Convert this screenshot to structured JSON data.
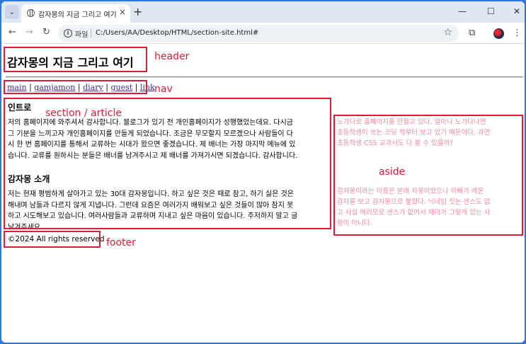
{
  "browser": {
    "tab_title": "감자몽의 지금 그리고 여기",
    "file_chip": "파일",
    "url": "C:/Users/AA/Desktop/HTML/section-site.html#",
    "new_tab_symbol": "+",
    "close_symbol": "×"
  },
  "page": {
    "header_title": "감자몽의 지금 그리고 여기",
    "nav": {
      "links": [
        "main",
        "gamjamon",
        "diary",
        "guest",
        "link"
      ],
      "separator": " | "
    },
    "article": {
      "heading1": "인트로",
      "para1": "저의 홈페이지에 와주셔서 감사합니다. 블로그가 있기 전 개인홈페이지가 성행했었는데요. 다시금\n그 기분을 느끼고자 개인홈페이지를 만들게 되었습니다. 조금은 무모할지 모르겠으나 사람들이 다\n시 한 번 홈페이지를 통해서 교류하는 시대가 왔으면 좋겠습니다. 제 배너는 가장 마지막 메뉴에 있\n습니다. 교류를 원하시는 분들은 배너를 남겨주시고 제 배너를 가져가시면 되겠습니다. 감사합니다.",
      "heading2": "감자몽 소개",
      "para2": "저는 현재 평범하게 살아가고 있는 30대 감자몽입니다. 하고 싶은 것은 때로 참고, 하기 싫은 것은\n해내며 남들과 다르지 않게 지냅니다. 그런데 요즘은 여러가지 배워보고 싶은 것들이 많아 참지 못\n하고 시도해보고 있습니다. 여러사람들과 교류하며 지내고 싶은 마음이 있습니다. 주저하지 말고 글\n남겨주세요."
    },
    "aside": {
      "text1": "노가다로 홈페이지를 만들고 있다. 얼마나 노가다냐면\n초등학생이 쓰는 코딩 책부터 보고 있기 때문이다. 과연\n초등학생 CSS 교과서도 다 볼 수 있을까?",
      "text2": "감자몽이라는 이름은 본래 자몽이었으나 아빠가 캐온\n감자를 보고 감자몽으로 불렀다. 닉네임 짓는 센스도 없\n고 사실 여러모로 센스가 없어서 재미가 그렇게 있는 사\n람이 아니다."
    },
    "footer": "©2024 All rights reserved"
  },
  "annotations": {
    "header": "header",
    "nav": "nav",
    "section": "section / article",
    "aside": "aside",
    "footer": "footer"
  },
  "colors": {
    "annotation": "#d61f3a",
    "aside_text": "#f08a9c",
    "link": "#4b2a8c",
    "desktop": "#2f76d6"
  }
}
